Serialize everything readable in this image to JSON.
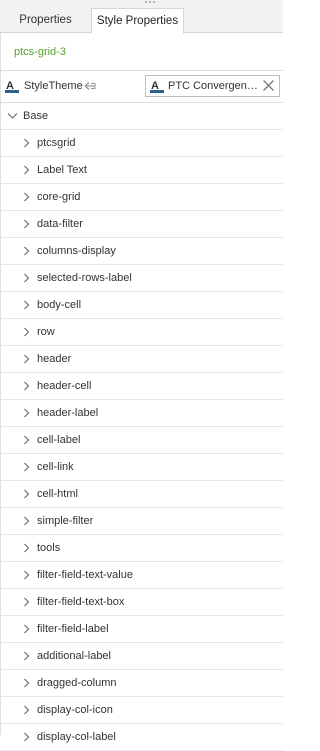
{
  "tabs": [
    {
      "label": "Properties",
      "active": false
    },
    {
      "label": "Style Properties",
      "active": true
    }
  ],
  "widget_name": "ptcs-grid-3",
  "style_theme": {
    "label": "StyleTheme",
    "icon": "style-theme-icon",
    "link_icon": "link-arrow-icon",
    "selected_value": "PTC Convergence Theme",
    "clear_icon": "close-icon"
  },
  "group": {
    "label": "Base",
    "expanded": true
  },
  "items": [
    {
      "label": "ptcsgrid"
    },
    {
      "label": "Label Text"
    },
    {
      "label": "core-grid"
    },
    {
      "label": "data-filter"
    },
    {
      "label": "columns-display"
    },
    {
      "label": "selected-rows-label"
    },
    {
      "label": "body-cell"
    },
    {
      "label": "row"
    },
    {
      "label": "header"
    },
    {
      "label": "header-cell"
    },
    {
      "label": "header-label"
    },
    {
      "label": "cell-label"
    },
    {
      "label": "cell-link"
    },
    {
      "label": "cell-html"
    },
    {
      "label": "simple-filter"
    },
    {
      "label": "tools"
    },
    {
      "label": "filter-field-text-value"
    },
    {
      "label": "filter-field-text-box"
    },
    {
      "label": "filter-field-label"
    },
    {
      "label": "additional-label"
    },
    {
      "label": "dragged-column"
    },
    {
      "label": "display-col-icon"
    },
    {
      "label": "display-col-label"
    }
  ],
  "colors": {
    "accent_green": "#5aa02c",
    "tab_bar": "#f2f2f2",
    "text": "#333333",
    "border": "#d6d6d6",
    "theme_icon_blue": "#2f5f8f"
  }
}
